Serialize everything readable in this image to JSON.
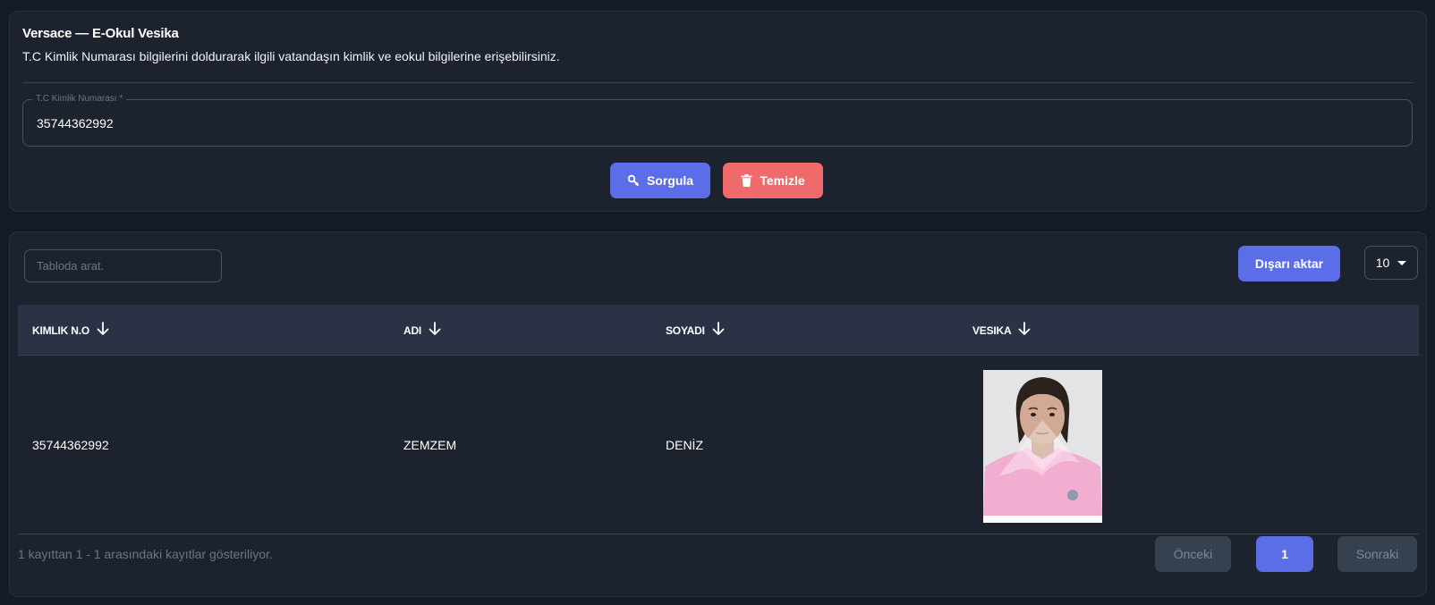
{
  "header": {
    "title": "Versace — E-Okul Vesika",
    "description": "T.C Kimlik Numarası bilgilerini doldurarak ilgili vatandaşın kimlik ve eokul bilgilerine erişebilirsiniz."
  },
  "form": {
    "tc_label": "T.C Kimlik Numarası *",
    "tc_value": "35744362992",
    "query_button": "Sorgula",
    "clear_button": "Temizle"
  },
  "table_controls": {
    "search_placeholder": "Tabloda arat.",
    "export_button": "Dışarı aktar",
    "page_size": "10"
  },
  "table": {
    "columns": [
      "KIMLIK N.O",
      "ADI",
      "SOYADI",
      "VESIKA"
    ],
    "rows": [
      {
        "kimlik_no": "35744362992",
        "adi": "ZEMZEM",
        "soyadi": "DENİZ"
      }
    ]
  },
  "pagination": {
    "info": "1 kayıttan 1 - 1 arasındaki kayıtlar gösteriliyor.",
    "prev": "Önceki",
    "current": "1",
    "next": "Sonraki"
  },
  "colors": {
    "background": "#151b24",
    "card": "#1c232e",
    "primary": "#5b6ee8",
    "danger": "#ef6a6a",
    "table_header": "#2b3245"
  },
  "icons": {
    "query": "search-icon",
    "clear": "trash-icon",
    "sort": "arrow-down-icon",
    "dropdown": "caret-down-icon"
  }
}
